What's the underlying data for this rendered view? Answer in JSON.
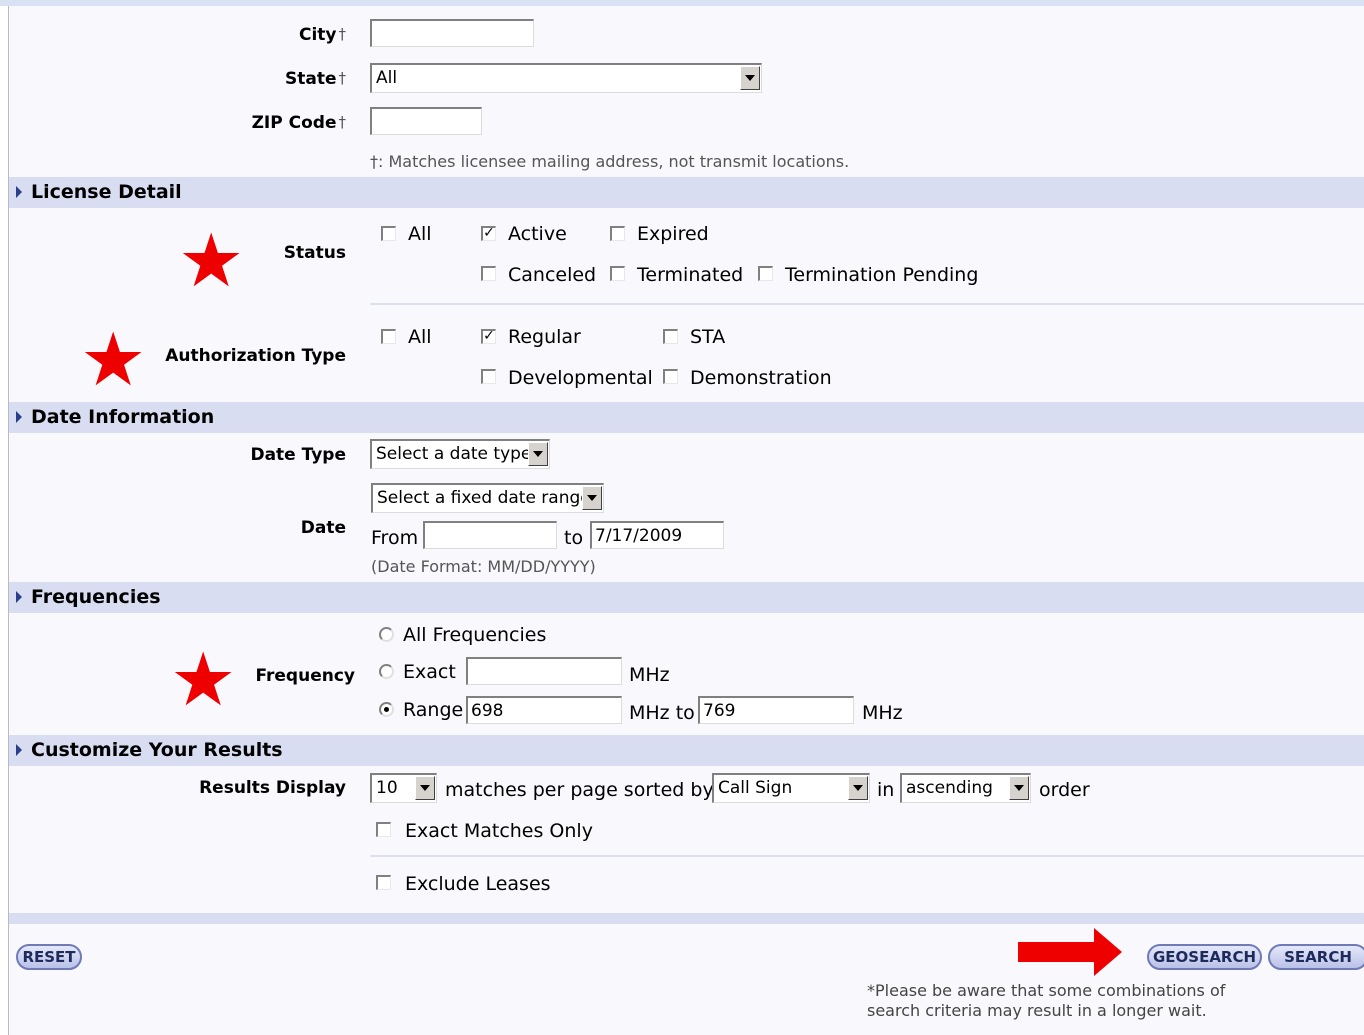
{
  "location": {
    "city_label": "City",
    "state_label": "State",
    "zip_label": "ZIP Code",
    "dagger": "†",
    "city_value": "",
    "state_value": "All",
    "zip_value": "",
    "footnote": "†: Matches licensee mailing address, not transmit locations."
  },
  "license_detail": {
    "title": "License Detail",
    "status_label": "Status",
    "status_options": [
      {
        "label": "All",
        "checked": false
      },
      {
        "label": "Active",
        "checked": true
      },
      {
        "label": "Expired",
        "checked": false
      },
      {
        "label": "Canceled",
        "checked": false
      },
      {
        "label": "Terminated",
        "checked": false
      },
      {
        "label": "Termination Pending",
        "checked": false
      }
    ],
    "auth_label": "Authorization Type",
    "auth_options": [
      {
        "label": "All",
        "checked": false
      },
      {
        "label": "Regular",
        "checked": true
      },
      {
        "label": "STA",
        "checked": false
      },
      {
        "label": "Developmental",
        "checked": false
      },
      {
        "label": "Demonstration",
        "checked": false
      }
    ]
  },
  "date_info": {
    "title": "Date Information",
    "date_type_label": "Date Type",
    "date_type_value": "Select a date type",
    "date_label": "Date",
    "range_value": "Select a fixed date range",
    "from_label": "From",
    "from_value": "",
    "to_label": "to",
    "to_value": "7/17/2009",
    "format_note": "(Date Format: MM/DD/YYYY)"
  },
  "frequencies": {
    "title": "Frequencies",
    "label": "Frequency",
    "all_label": "All Frequencies",
    "exact_label": "Exact",
    "exact_value": "",
    "range_label": "Range",
    "range_from": "698",
    "range_to": "769",
    "mhz": "MHz",
    "mhz_to": "MHz to",
    "selected": "Range"
  },
  "customize": {
    "title": "Customize Your Results",
    "results_label": "Results Display",
    "per_page_value": "10",
    "per_page_text": "matches per page sorted by",
    "sort_value": "Call Sign",
    "in_text": "in",
    "order_value": "ascending",
    "order_text": "order",
    "exact_only": "Exact Matches Only",
    "exclude_leases": "Exclude Leases"
  },
  "actions": {
    "reset": "RESET",
    "geosearch": "GEOSEARCH",
    "search": "SEARCH",
    "warning_line1": "*Please be aware that some combinations of",
    "warning_line2": "search criteria may result in a longer wait."
  },
  "annotations": {
    "star_color": "#ee0000",
    "arrow_color": "#ee0000"
  }
}
